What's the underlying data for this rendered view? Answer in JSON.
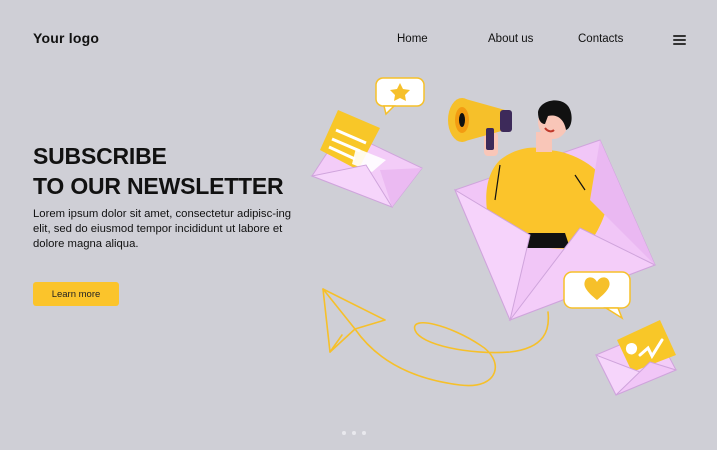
{
  "header": {
    "logo": "Your logo",
    "nav": [
      {
        "label": "Home"
      },
      {
        "label": "About us"
      },
      {
        "label": "Contacts"
      }
    ],
    "menu_icon": "hamburger-menu-icon"
  },
  "hero": {
    "title_line1": "SUBSCRIBE",
    "title_line2": "TO OUR NEWSLETTER",
    "body": "Lorem ipsum dolor sit amet, consectetur adipisc-ing elit, sed do eiusmod tempor incididunt ut labore et dolore magna aliqua.",
    "cta_label": "Learn more"
  },
  "pagination": {
    "count": 3
  },
  "colors": {
    "background": "#cfcfd6",
    "accent": "#fbc42b",
    "envelope": "#f4cdf9",
    "ink": "#111111"
  },
  "illustration": {
    "icons": [
      "megaphone-icon",
      "star-icon",
      "heart-icon",
      "paper-plane-icon",
      "envelope-icon"
    ]
  }
}
